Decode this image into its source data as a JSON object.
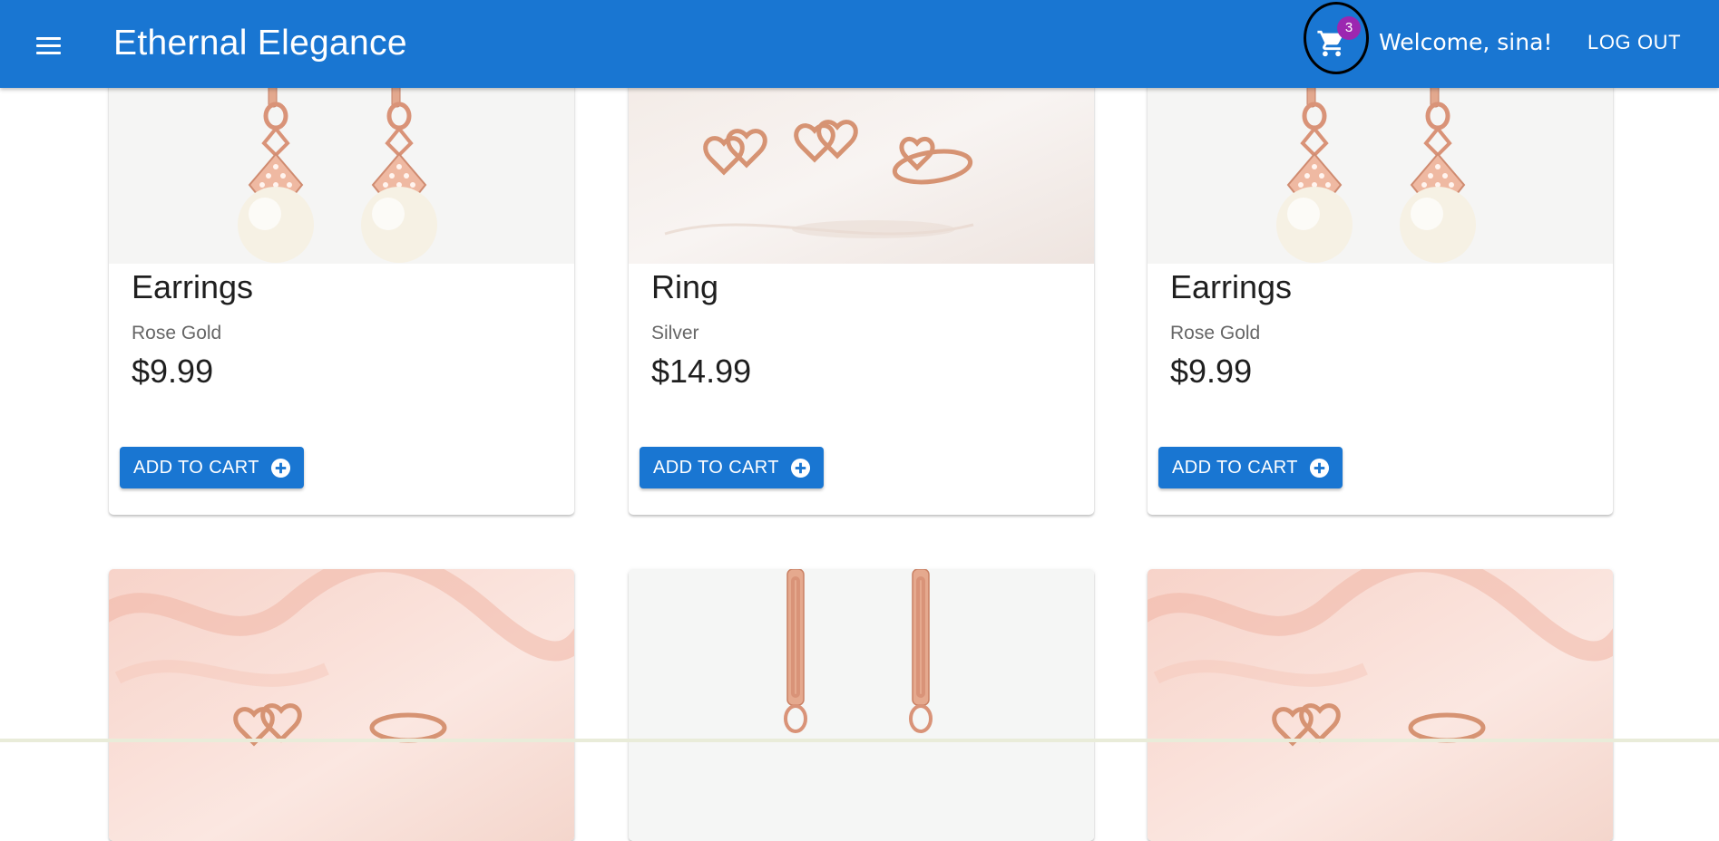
{
  "app": {
    "title": "Ethernal Elegance",
    "welcome": "Welcome, sina!",
    "logout_label": "LOG OUT",
    "cart_count": "3",
    "menu_icon": "menu-icon",
    "cart_icon": "shopping-cart-icon"
  },
  "colors": {
    "appbar": "#1976d2",
    "badge": "#9c27b0",
    "rose_gold": "#e6a78c",
    "pearl": "#f4efe2"
  },
  "products": [
    {
      "name": "Earrings",
      "material": "Rose Gold",
      "price": "$9.99",
      "button": "ADD TO CART",
      "image": "pearl-earrings"
    },
    {
      "name": "Ring",
      "material": "Silver",
      "price": "$14.99",
      "button": "ADD TO CART",
      "image": "heart-earrings-and-ring"
    },
    {
      "name": "Earrings",
      "material": "Rose Gold",
      "price": "$9.99",
      "button": "ADD TO CART",
      "image": "pearl-earrings"
    },
    {
      "image": "heart-jewelry-on-pink-ribbon"
    },
    {
      "image": "hoop-earrings"
    },
    {
      "image": "heart-jewelry-on-pink-ribbon"
    }
  ]
}
